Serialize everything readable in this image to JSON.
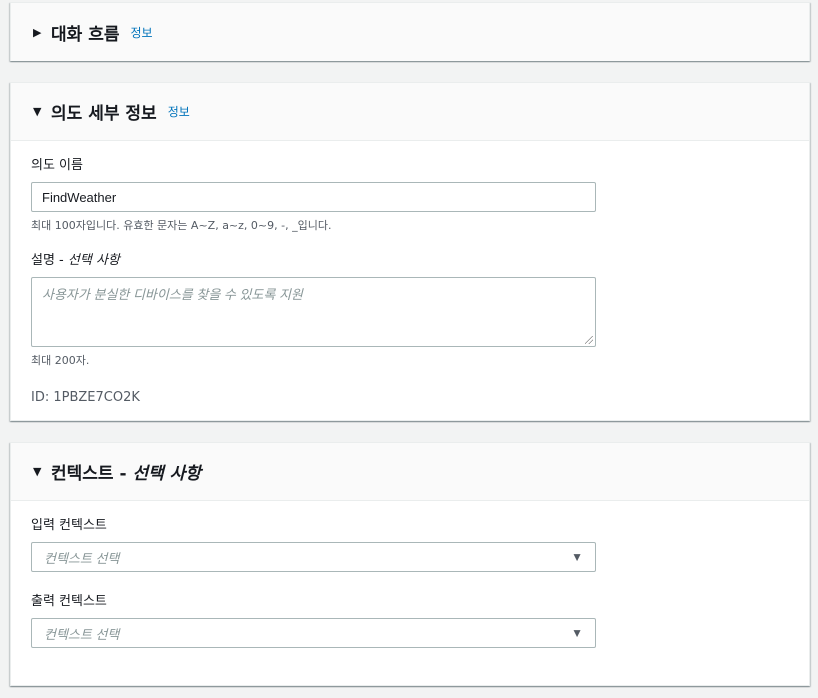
{
  "sections": {
    "conversation_flow": {
      "title": "대화 흐름",
      "info": "정보",
      "expanded": false
    },
    "intent_details": {
      "title": "의도 세부 정보",
      "info": "정보",
      "expanded": true,
      "name_field": {
        "label": "의도 이름",
        "value": "FindWeather",
        "hint": "최대 100자입니다. 유효한 문자는 A~Z, a~z, 0~9, -, _입니다."
      },
      "description_field": {
        "label_main": "설명 - ",
        "label_optional": "선택 사항",
        "placeholder": "사용자가 분실한 디바이스를 찾을 수 있도록 지원",
        "hint": "최대 200자."
      },
      "id_text": "ID: 1PBZE7CO2K"
    },
    "contexts": {
      "title_main": "컨텍스트 - ",
      "title_optional": "선택 사항",
      "expanded": true,
      "input_context": {
        "label": "입력 컨텍스트",
        "placeholder": "컨텍스트 선택"
      },
      "output_context": {
        "label": "출력 컨텍스트",
        "placeholder": "컨텍스트 선택"
      }
    }
  },
  "icons": {
    "collapsed": "caret-right-icon",
    "expanded": "caret-down-icon",
    "dropdown": "chevron-down-icon"
  },
  "colors": {
    "background": "#f2f3f3",
    "panel_header": "#fafafa",
    "link": "#0073bb",
    "border": "#aab7b8"
  }
}
